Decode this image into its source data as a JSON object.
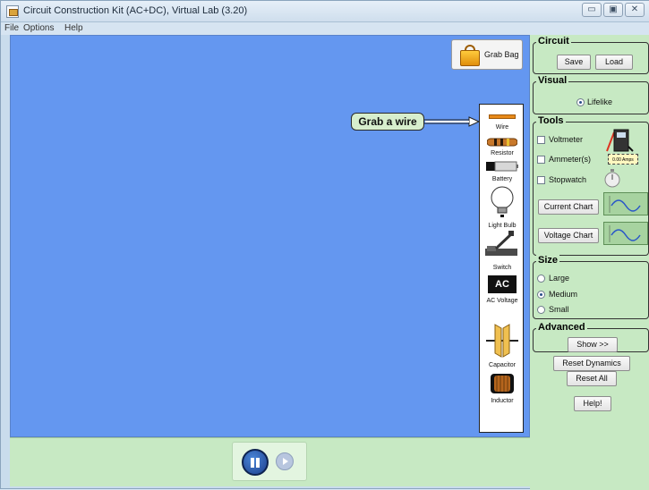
{
  "window": {
    "title": "Circuit Construction Kit (AC+DC), Virtual Lab (3.20)"
  },
  "menu": {
    "file": "File",
    "options": "Options",
    "help": "Help"
  },
  "canvas": {
    "grab_bag": "Grab Bag",
    "callout": "Grab a wire"
  },
  "toolbox": {
    "wire": "Wire",
    "resistor": "Resistor",
    "battery": "Battery",
    "light_bulb": "Light Bulb",
    "switch": "Switch",
    "ac_voltage": "AC Voltage",
    "ac_badge": "AC",
    "capacitor": "Capacitor",
    "inductor": "Inductor"
  },
  "sidebar": {
    "circuit": {
      "title": "Circuit",
      "save": "Save",
      "load": "Load"
    },
    "visual": {
      "title": "Visual",
      "lifelike": "Lifelike"
    },
    "tools": {
      "title": "Tools",
      "voltmeter": "Voltmeter",
      "ammeter": "Ammeter(s)",
      "ammeter_readout": "0.00 Amps",
      "stopwatch": "Stopwatch",
      "current_chart": "Current Chart",
      "voltage_chart": "Voltage Chart"
    },
    "size": {
      "title": "Size",
      "large": "Large",
      "medium": "Medium",
      "small": "Small",
      "selected": "Medium"
    },
    "advanced": {
      "title": "Advanced",
      "show": "Show >>"
    },
    "reset_dynamics": "Reset Dynamics",
    "reset_all": "Reset All",
    "help": "Help!"
  },
  "colors": {
    "canvas": "#6497f0",
    "panel": "#c7e9c3",
    "callout": "#d7eecd"
  }
}
